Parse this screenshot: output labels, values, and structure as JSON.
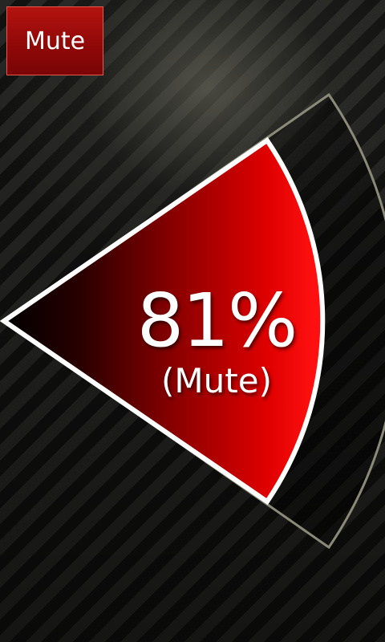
{
  "toolbar": {
    "mute_label": "Mute"
  },
  "volume": {
    "level_percent": 81,
    "percent_text": "81%",
    "status_text": "(Mute)"
  },
  "colors": {
    "accent": "#e00000",
    "button_bg": "#9a0a0a",
    "button_border": "#e85a4f",
    "outline": "#ffffff",
    "track_outline": "#8a8a78"
  }
}
